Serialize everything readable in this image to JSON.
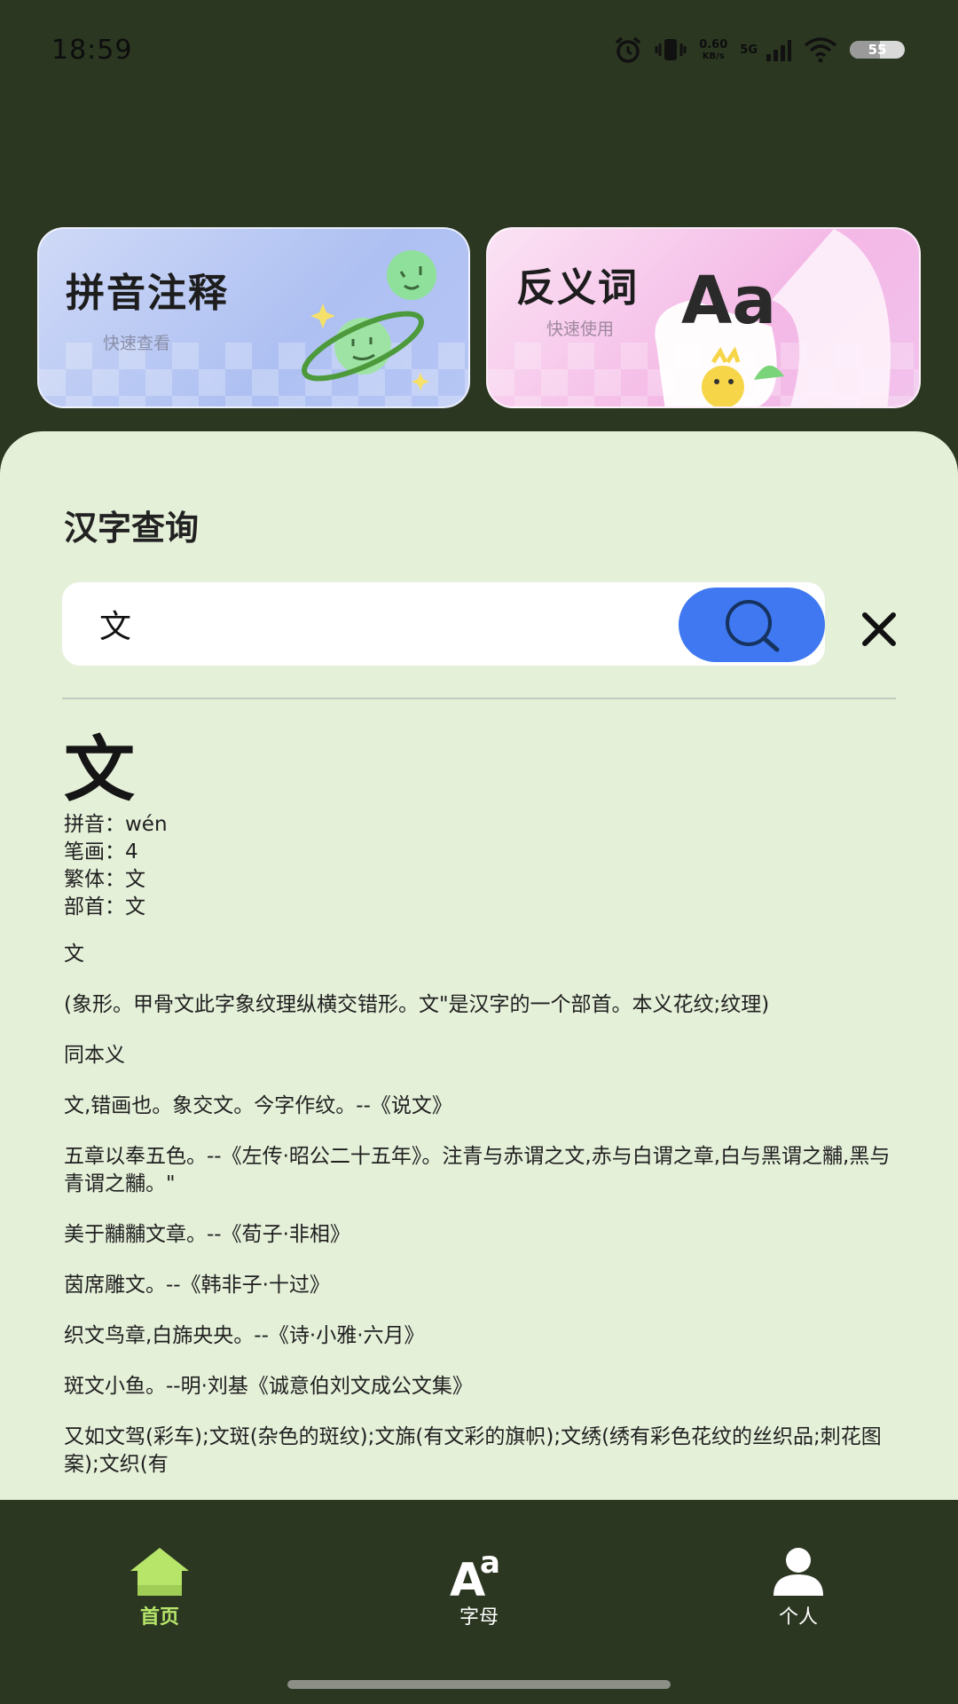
{
  "status_bar": {
    "time": "18:59",
    "net_speed_value": "0.60",
    "net_speed_unit": "KB/s",
    "network": "5G",
    "battery": "55"
  },
  "cards": {
    "pinyin": {
      "title": "拼音注释",
      "subtitle": "快速查看"
    },
    "antonym": {
      "title": "反义词",
      "subtitle": "快速使用",
      "badge": "Aa"
    }
  },
  "lookup": {
    "title": "汉字查询",
    "search_value": "文",
    "search_icon": "search-icon",
    "clear_icon": "close-icon"
  },
  "result": {
    "character": "文",
    "attributes": [
      "拼音：wén",
      "笔画：4",
      "繁体：文",
      "部首：文"
    ],
    "definitions": [
      "文",
      " (象形。甲骨文此字象纹理纵横交错形。文\"是汉字的一个部首。本义花纹;纹理)",
      " 同本义",
      " 文,错画也。象交文。今字作纹。--《说文》",
      " 五章以奉五色。--《左传·昭公二十五年》。注青与赤谓之文,赤与白谓之章,白与黑谓之黼,黑与青谓之黼。\"",
      " 美于黼黼文章。--《荀子·非相》",
      " 茵席雕文。--《韩非子·十过》",
      " 织文鸟章,白旆央央。--《诗·小雅·六月》",
      " 斑文小鱼。--明·刘基《诚意伯刘文成公文集》",
      " 又如文驾(彩车);文斑(杂色的斑纹);文旆(有文彩的旗帜);文绣(绣有彩色花纹的丝织品;刺花图案);文织(有"
    ]
  },
  "bottom_nav": {
    "items": [
      {
        "label": "首页",
        "icon": "home-icon",
        "active": true
      },
      {
        "label": "字母",
        "icon": "letters-icon",
        "active": false
      },
      {
        "label": "个人",
        "icon": "person-icon",
        "active": false
      }
    ]
  },
  "colors": {
    "background": "#2b3721",
    "panel": "#e5f0d9",
    "accent_blue": "#3f78f0",
    "nav_active": "#b6e56a"
  }
}
